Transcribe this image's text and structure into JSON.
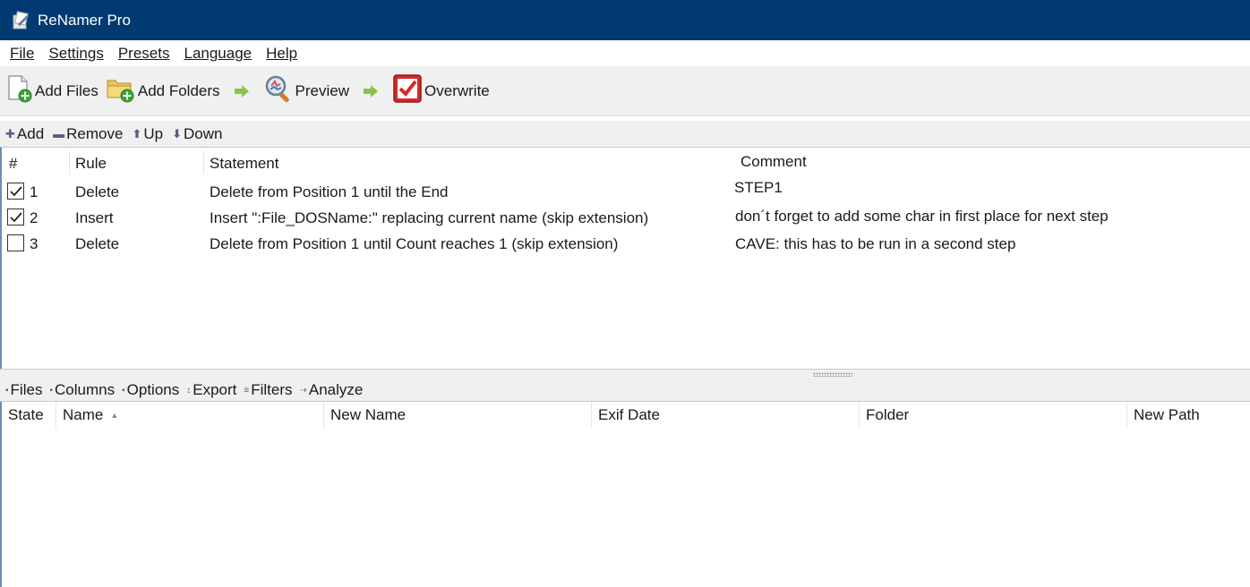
{
  "app": {
    "title": "ReNamer Pro"
  },
  "menu": [
    {
      "label": "File"
    },
    {
      "label": "Settings"
    },
    {
      "label": "Presets"
    },
    {
      "label": "Language"
    },
    {
      "label": "Help"
    }
  ],
  "toolbar": {
    "add_files": "Add Files",
    "add_folders": "Add Folders",
    "preview": "Preview",
    "overwrite": "Overwrite"
  },
  "rules_toolbar": {
    "add": "Add",
    "remove": "Remove",
    "up": "Up",
    "down": "Down"
  },
  "rules_table": {
    "headers": {
      "num": "#",
      "rule": "Rule",
      "statement": "Statement",
      "comment": "Comment"
    },
    "rows": [
      {
        "checked": true,
        "num": "1",
        "rule": "Delete",
        "statement": "Delete from Position 1 until the End",
        "comment": "STEP1"
      },
      {
        "checked": true,
        "num": "2",
        "rule": "Insert",
        "statement": "Insert \":File_DOSName:\" replacing current name (skip extension)",
        "comment": "don´t forget to add some char in first place for next step"
      },
      {
        "checked": false,
        "num": "3",
        "rule": "Delete",
        "statement": "Delete from Position 1 until Count reaches 1 (skip extension)",
        "comment": "CAVE: this has to be run in a second step"
      }
    ]
  },
  "files_toolbar": {
    "files": "Files",
    "columns": "Columns",
    "options": "Options",
    "export": "Export",
    "filters": "Filters",
    "analyze": "Analyze"
  },
  "files_table": {
    "headers": {
      "state": "State",
      "name": "Name",
      "new_name": "New Name",
      "exif_date": "Exif Date",
      "folder": "Folder",
      "new_path": "New Path"
    }
  }
}
